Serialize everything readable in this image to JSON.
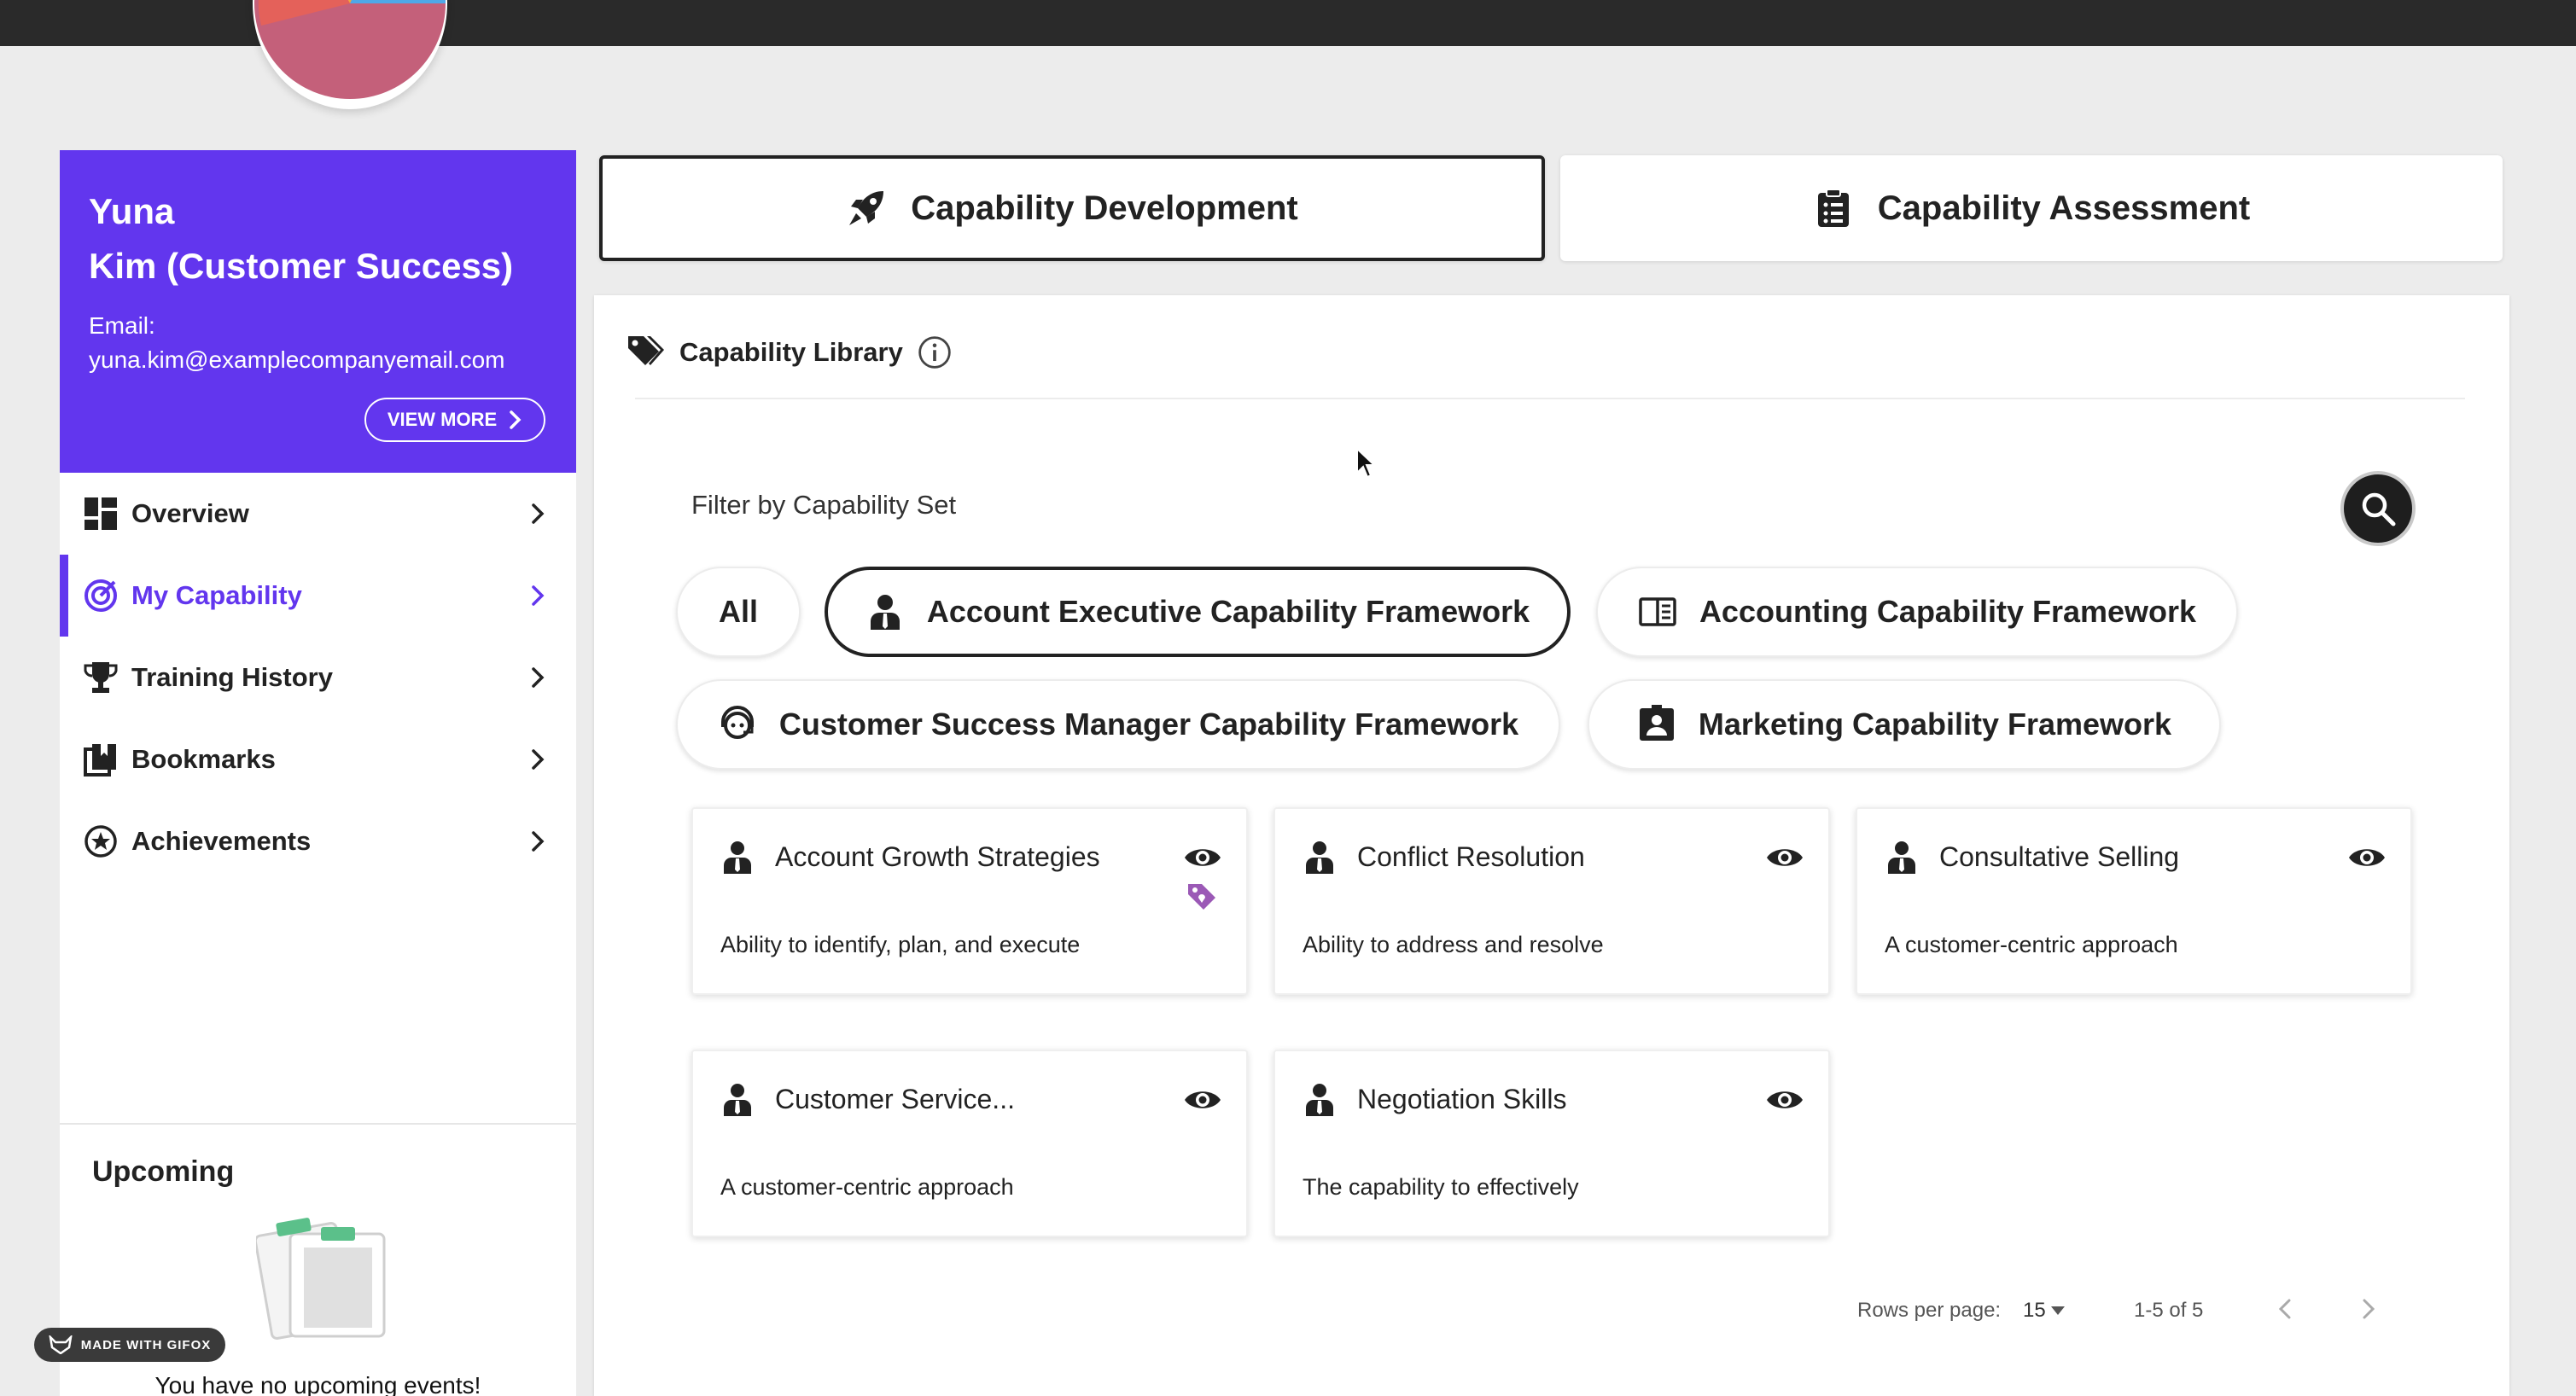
{
  "profile": {
    "name_line1": "Yuna",
    "name_line2": "Kim (Customer Success)",
    "email_label": "Email:",
    "email": "yuna.kim@examplecompanyemail.com",
    "view_more": "VIEW MORE"
  },
  "nav": {
    "items": [
      {
        "label": "Overview",
        "icon": "dashboard-icon"
      },
      {
        "label": "My Capability",
        "icon": "target-icon"
      },
      {
        "label": "Training History",
        "icon": "trophy-icon"
      },
      {
        "label": "Bookmarks",
        "icon": "bookmarks-icon"
      },
      {
        "label": "Achievements",
        "icon": "star-badge-icon"
      }
    ],
    "active": "My Capability"
  },
  "upcoming": {
    "title": "Upcoming",
    "empty_text": "You have no upcoming events!"
  },
  "badge": "MADE WITH GIFOX",
  "tabs": {
    "development": "Capability Development",
    "assessment": "Capability Assessment"
  },
  "library": {
    "title": "Capability Library",
    "filter_label": "Filter by Capability Set",
    "chips": [
      {
        "label": "All"
      },
      {
        "label": "Account Executive Capability Framework",
        "icon": "person-icon",
        "selected": true
      },
      {
        "label": "Accounting Capability Framework",
        "icon": "book-open-icon"
      },
      {
        "label": "Customer Success Manager Capability Framework",
        "icon": "headset-icon"
      },
      {
        "label": "Marketing Capability Framework",
        "icon": "id-card-icon"
      }
    ],
    "cards": [
      {
        "title": "Account Growth Strategies",
        "description": "Ability to identify, plan, and execute",
        "tagged": true
      },
      {
        "title": "Conflict Resolution",
        "description": "Ability to address and resolve"
      },
      {
        "title": "Consultative Selling",
        "description": "A customer-centric approach"
      },
      {
        "title": "Customer Service...",
        "description": "A customer-centric approach"
      },
      {
        "title": "Negotiation Skills",
        "description": "The capability to effectively"
      }
    ]
  },
  "pagination": {
    "rows_label": "Rows per page:",
    "rows_value": "15",
    "range": "1-5 of 5"
  },
  "colors": {
    "accent": "#6236ee",
    "tag": "#9b59b6"
  }
}
